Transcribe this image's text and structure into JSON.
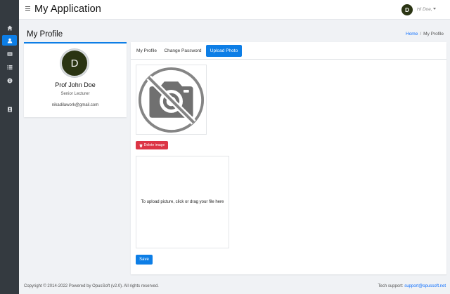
{
  "app": {
    "title": "My Application",
    "menu_icon": "hamburger-menu-icon"
  },
  "user": {
    "avatar_initial": "D",
    "greeting": "Hi Doe,"
  },
  "sidebar": {
    "items": [
      {
        "icon": "home-icon",
        "active": false
      },
      {
        "icon": "user-icon",
        "active": true
      },
      {
        "icon": "id-card-icon",
        "active": false
      },
      {
        "icon": "list-icon",
        "active": false
      },
      {
        "icon": "info-icon",
        "active": false
      },
      {
        "icon": "contact-card-icon",
        "active": false
      }
    ]
  },
  "page": {
    "title": "My Profile",
    "breadcrumb": {
      "home": "Home",
      "separator": "/",
      "current": "My Profile"
    }
  },
  "profile": {
    "avatar_initial": "D",
    "name": "Prof John Doe",
    "role": "Senior Lecturer",
    "email": "nikadilawork@gmail.com"
  },
  "tabs": [
    {
      "label": "My Profile",
      "active": false
    },
    {
      "label": "Change Password",
      "active": false
    },
    {
      "label": "Upload Photo",
      "active": true
    }
  ],
  "upload": {
    "placeholder_icon": "no-camera-icon",
    "delete_label": "Delete image",
    "dropzone_text": "To upload picture, click or drag your file here",
    "save_label": "Save"
  },
  "footer": {
    "copyright": "Copyright © 2014-2022 Powered by OpusSoft (v2.0). All rights reserved.",
    "support_label": "Tech support:",
    "support_email": "support@opussoft.net"
  },
  "colors": {
    "primary": "#0d7ee6",
    "danger": "#dc3545",
    "sidebar": "#343a40",
    "avatar": "#2a3413"
  }
}
